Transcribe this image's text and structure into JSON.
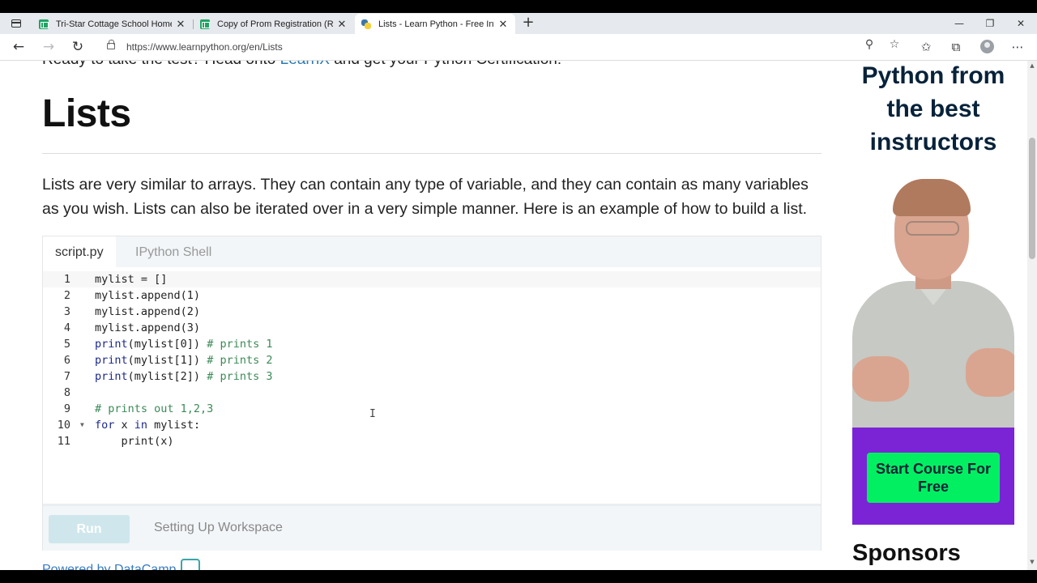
{
  "browser": {
    "tabs": [
      {
        "title": "Tri-Star Cottage School Homesch",
        "icon": "sheets-icon",
        "active": false
      },
      {
        "title": "Copy of Prom Registration (Resp",
        "icon": "sheets-icon",
        "active": false
      },
      {
        "title": "Lists - Learn Python - Free Intera",
        "icon": "python-icon",
        "active": true
      }
    ],
    "url": "https://www.learnpython.org/en/Lists"
  },
  "page": {
    "ready_prefix": "Ready to take the test? Head onto ",
    "ready_link": "LearnX",
    "ready_suffix": " and get your Python Certification!",
    "heading": "Lists",
    "intro": "Lists are very similar to arrays. They can contain any type of variable, and they can contain as many variables as you wish. Lists can also be iterated over in a very simple manner. Here is an example of how to build a list.",
    "editor": {
      "tabs": [
        "script.py",
        "IPython Shell"
      ],
      "lines": [
        {
          "num": "1",
          "code": "mylist = []"
        },
        {
          "num": "2",
          "code": "mylist.append(1)"
        },
        {
          "num": "3",
          "code": "mylist.append(2)"
        },
        {
          "num": "4",
          "code": "mylist.append(3)"
        },
        {
          "num": "5",
          "kw": "print",
          "code": "(mylist[0]) ",
          "comment": "# prints 1"
        },
        {
          "num": "6",
          "kw": "print",
          "code": "(mylist[1]) ",
          "comment": "# prints 2"
        },
        {
          "num": "7",
          "kw": "print",
          "code": "(mylist[2]) ",
          "comment": "# prints 3"
        },
        {
          "num": "8",
          "code": ""
        },
        {
          "num": "9",
          "comment": "# prints out 1,2,3"
        },
        {
          "num": "10",
          "kw": "for",
          "code": " x ",
          "kw2": "in",
          "code2": " mylist:"
        },
        {
          "num": "11",
          "code": "    print(x)"
        }
      ],
      "run_label": "Run",
      "status": "Setting Up Workspace"
    },
    "powered_by": "Powered by DataCamp"
  },
  "ad": {
    "title": "Python from the best instructors",
    "cta": "Start Course For Free"
  },
  "sidebar": {
    "sponsors_heading": "Sponsors"
  },
  "colors": {
    "link": "#2a7ab0",
    "keyword": "#1c2a8c",
    "comment": "#3b8a57",
    "cta_green": "#03ef62",
    "ad_purple": "#7a24d6"
  }
}
